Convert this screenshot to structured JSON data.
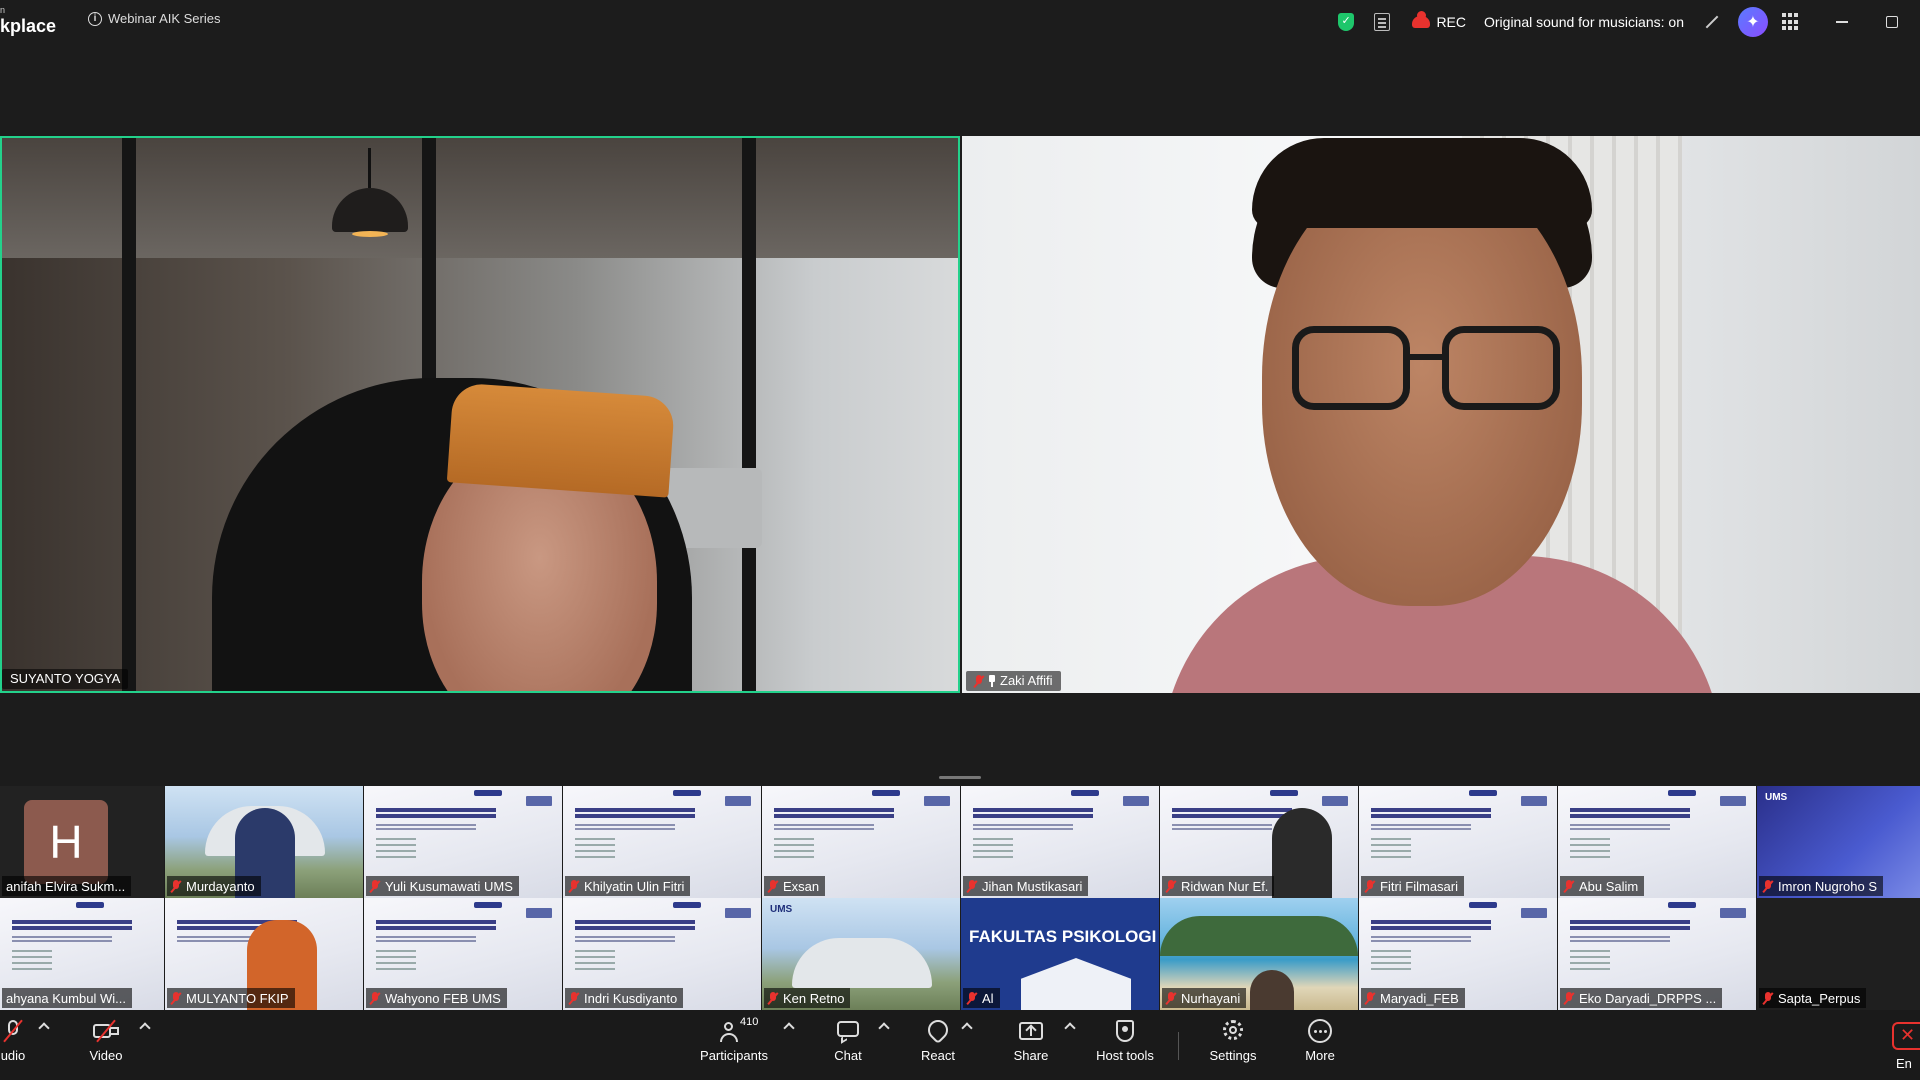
{
  "app": {
    "brand_small": "n",
    "brand_text": "kplace",
    "meeting_title": "Webinar AIK Series"
  },
  "topbar": {
    "rec_label": "REC",
    "sound_label": "Original sound for musicians: on",
    "security_color": "#1ec66b",
    "rec_color": "#e8322e"
  },
  "speakers": [
    {
      "name": "SUYANTO YOGYA",
      "muted": false,
      "active_speaker": true
    },
    {
      "name": "Zaki Affifi",
      "muted": true,
      "pinned": true
    }
  ],
  "thumbnails_row1": [
    {
      "name": "anifah Elvira Sukm...",
      "kind": "avatar",
      "initial": "H"
    },
    {
      "name": "Murdayanto",
      "kind": "photo"
    },
    {
      "name": "Yuli Kusumawati UMS",
      "kind": "slide"
    },
    {
      "name": "Khilyatin Ulin Fitri",
      "kind": "slide"
    },
    {
      "name": "Exsan",
      "kind": "slide"
    },
    {
      "name": "Jihan Mustikasari",
      "kind": "slide"
    },
    {
      "name": "Ridwan Nur Ef.",
      "kind": "slide"
    },
    {
      "name": "Fitri Filmasari",
      "kind": "slide"
    },
    {
      "name": "Abu Salim",
      "kind": "slide"
    },
    {
      "name": "Imron Nugroho S",
      "kind": "ums"
    }
  ],
  "thumbnails_row2": [
    {
      "name": "ahyana Kumbul Wi...",
      "kind": "slide"
    },
    {
      "name": "MULYANTO FKIP",
      "kind": "slide"
    },
    {
      "name": "Wahyono FEB UMS",
      "kind": "slide"
    },
    {
      "name": "Indri Kusdiyanto",
      "kind": "slide"
    },
    {
      "name": "Ken Retno",
      "kind": "ums-photo"
    },
    {
      "name": "Al",
      "kind": "psikologi"
    },
    {
      "name": "Nurhayani",
      "kind": "sea"
    },
    {
      "name": "Maryadi_FEB",
      "kind": "slide"
    },
    {
      "name": "Eko Daryadi_DRPPS ...",
      "kind": "slide"
    },
    {
      "name": "Sapta_Perpus",
      "kind": "dark"
    }
  ],
  "tile_text": {
    "ums": "UMS",
    "psikologi_title": "FAKULTAS PSIKOLOGI"
  },
  "toolbar": {
    "audio": "udio",
    "video": "Video",
    "participants": "Participants",
    "participants_count": "410",
    "chat": "Chat",
    "react": "React",
    "share": "Share",
    "host_tools": "Host tools",
    "settings": "Settings",
    "more": "More",
    "end": "End"
  }
}
